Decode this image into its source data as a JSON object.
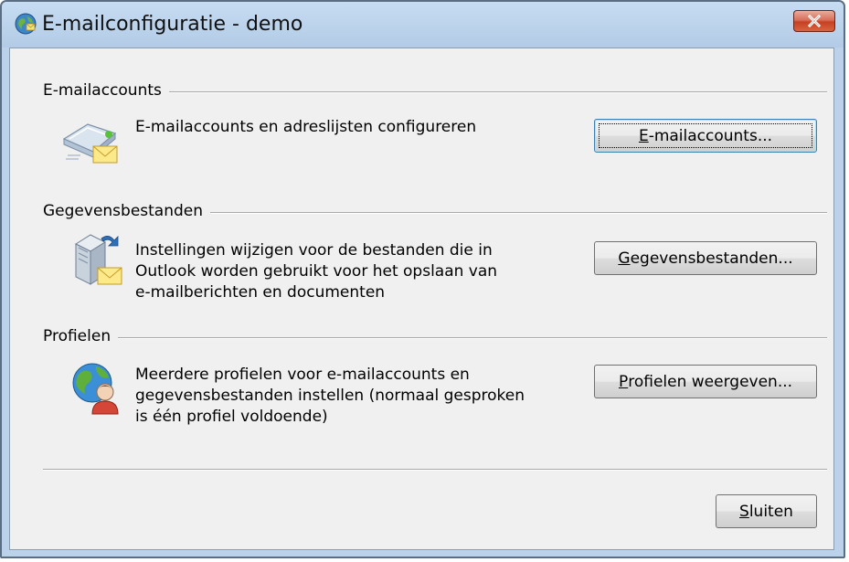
{
  "window": {
    "title": "E-mailconfiguratie - demo",
    "icons": {
      "app": "mail-setup-globe-icon",
      "close": "close-icon"
    }
  },
  "groups": {
    "accounts": {
      "title": "E-mailaccounts",
      "description": "E-mailaccounts en adreslijsten configureren",
      "button": {
        "mnemonic": "E",
        "rest": "-mailaccounts..."
      },
      "icon": "email-accounts-icon"
    },
    "datafiles": {
      "title": "Gegevensbestanden",
      "description_lines": [
        "Instellingen wijzigen voor de bestanden die in",
        "Outlook worden gebruikt voor het opslaan van",
        "e-mailberichten en documenten"
      ],
      "button": {
        "mnemonic": "G",
        "rest": "egevensbestanden..."
      },
      "icon": "data-files-icon"
    },
    "profiles": {
      "title": "Profielen",
      "description_lines": [
        "Meerdere profielen voor e-mailaccounts en",
        "gegevensbestanden instellen (normaal gesproken",
        "is één profiel voldoende)"
      ],
      "button": {
        "mnemonic": "P",
        "rest": "rofielen weergeven..."
      },
      "icon": "profiles-icon"
    }
  },
  "footer": {
    "close_button": {
      "mnemonic": "S",
      "rest": "luiten"
    }
  },
  "colors": {
    "titlebar": "#bcd2ea",
    "client": "#f0f0f0",
    "close_button": "#c54123",
    "focus_border": "#3c7fb1"
  }
}
